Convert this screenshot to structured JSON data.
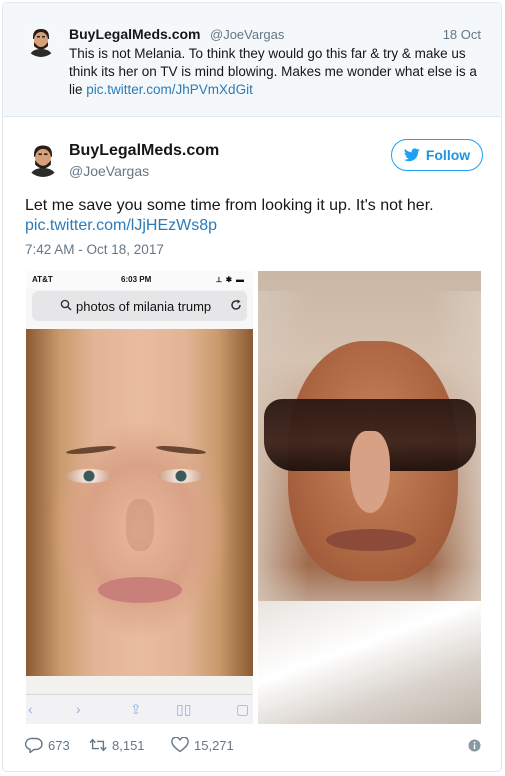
{
  "quoted_tweet": {
    "author_name": "BuyLegalMeds.com",
    "handle": "@JoeVargas",
    "date": "18 Oct",
    "text": "This is not Melania. To think they would go this far & try & make us think its her on TV is mind blowing. Makes me wonder what else is a lie ",
    "link": "pic.twitter.com/JhPVmXdGit"
  },
  "main_tweet": {
    "author_name": "BuyLegalMeds.com",
    "handle": "@JoeVargas",
    "follow_label": "Follow",
    "text": "Let me save you some time from looking it up. It's not her.",
    "link": "pic.twitter.com/lJjHEzWs8p",
    "timestamp": "7:42 AM - Oct 18, 2017"
  },
  "media": {
    "left_screenshot": {
      "carrier": "AT&T",
      "time": "6:03 PM",
      "status_icons": "⟂ ✱ ▬",
      "search_query": "photos of milania trump"
    }
  },
  "actions": {
    "replies": "673",
    "retweets": "8,151",
    "likes": "15,271"
  },
  "colors": {
    "accent": "#1da1f2",
    "link": "#2b7bb9",
    "muted": "#657786"
  }
}
